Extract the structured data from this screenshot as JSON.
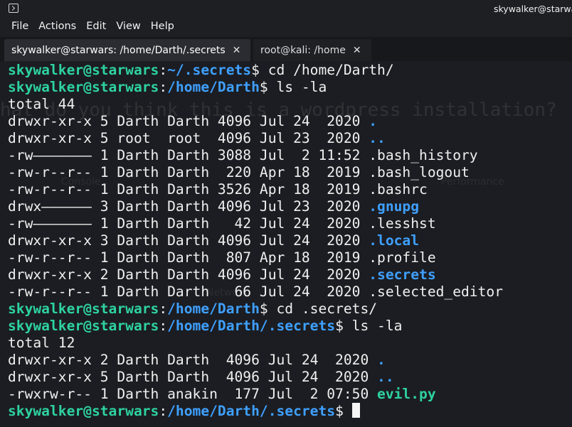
{
  "window": {
    "title": "skywalker@starwars: /home/Darth/.secrets"
  },
  "menu": [
    "File",
    "Actions",
    "Edit",
    "View",
    "Help"
  ],
  "tabs": [
    {
      "label": "skywalker@starwars: /home/Darth/.secrets",
      "active": true
    },
    {
      "label": "root@kali: /home",
      "active": false
    }
  ],
  "ghost_text": {
    "question": "hat do you think this is a wordpress installation?",
    "tab1": "Console",
    "tab2": "Performance",
    "tab3": "Network"
  },
  "colors": {
    "user": "#2ed2a0",
    "path": "#3fa0ff",
    "dir": "#3fa0ff",
    "exec": "#2ed2a0",
    "text": "#f0f0f0",
    "bg": "#1b1d22"
  },
  "terminal": {
    "prompt_user": "skywalker@starwars",
    "lines": [
      {
        "type": "prompt",
        "path": "~/.secrets",
        "cmd": " cd /home/Darth/"
      },
      {
        "type": "prompt",
        "path": "/home/Darth",
        "cmd": " ls -la"
      },
      {
        "type": "text",
        "text": "total 44"
      },
      {
        "type": "ls",
        "meta": "drwxr-xr-x 5 Darth Darth 4096 Jul 24  2020 ",
        "name": ".",
        "kind": "dir"
      },
      {
        "type": "ls",
        "meta": "drwxr-xr-x 5 root  root  4096 Jul 23  2020 ",
        "name": "..",
        "kind": "dir"
      },
      {
        "type": "ls",
        "meta": "-rw——————— 1 Darth Darth 3088 Jul  2 11:52 ",
        "name": ".bash_history",
        "kind": "file"
      },
      {
        "type": "ls",
        "meta": "-rw-r--r-- 1 Darth Darth  220 Apr 18  2019 ",
        "name": ".bash_logout",
        "kind": "file"
      },
      {
        "type": "ls",
        "meta": "-rw-r--r-- 1 Darth Darth 3526 Apr 18  2019 ",
        "name": ".bashrc",
        "kind": "file"
      },
      {
        "type": "ls",
        "meta": "drwx—————— 3 Darth Darth 4096 Jul 23  2020 ",
        "name": ".gnupg",
        "kind": "dir"
      },
      {
        "type": "ls",
        "meta": "-rw——————— 1 Darth Darth   42 Jul 24  2020 ",
        "name": ".lesshst",
        "kind": "file"
      },
      {
        "type": "ls",
        "meta": "drwxr-xr-x 3 Darth Darth 4096 Jul 24  2020 ",
        "name": ".local",
        "kind": "dir"
      },
      {
        "type": "ls",
        "meta": "-rw-r--r-- 1 Darth Darth  807 Apr 18  2019 ",
        "name": ".profile",
        "kind": "file"
      },
      {
        "type": "ls",
        "meta": "drwxr-xr-x 2 Darth Darth 4096 Jul 24  2020 ",
        "name": ".secrets",
        "kind": "dir"
      },
      {
        "type": "ls",
        "meta": "-rw-r--r-- 1 Darth Darth   66 Jul 24  2020 ",
        "name": ".selected_editor",
        "kind": "file"
      },
      {
        "type": "prompt",
        "path": "/home/Darth",
        "cmd": " cd .secrets/"
      },
      {
        "type": "prompt",
        "path": "/home/Darth/.secrets",
        "cmd": " ls -la"
      },
      {
        "type": "text",
        "text": "total 12"
      },
      {
        "type": "ls",
        "meta": "drwxr-xr-x 2 Darth Darth  4096 Jul 24  2020 ",
        "name": ".",
        "kind": "dir"
      },
      {
        "type": "ls",
        "meta": "drwxr-xr-x 5 Darth Darth  4096 Jul 24  2020 ",
        "name": "..",
        "kind": "dir"
      },
      {
        "type": "ls",
        "meta": "-rwxrw-r-- 1 Darth anakin  177 Jul  2 07:50 ",
        "name": "evil.py",
        "kind": "exec"
      },
      {
        "type": "prompt",
        "path": "/home/Darth/.secrets",
        "cmd": " ",
        "cursor": true
      }
    ]
  }
}
